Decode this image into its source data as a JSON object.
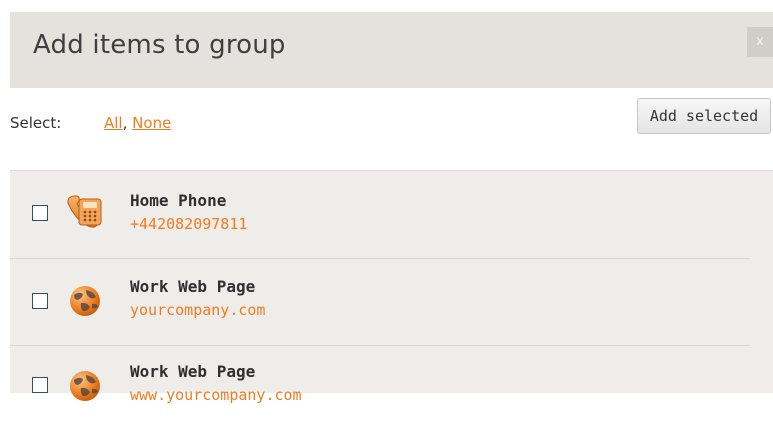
{
  "dialog": {
    "title": "Add items to group",
    "close_label": "x"
  },
  "toolbar": {
    "select_label": "Select:",
    "all_label": "All",
    "separator": ",",
    "none_label": "None",
    "add_selected_label": "Add selected"
  },
  "items": [
    {
      "name": "Home Phone",
      "value": "+442082097811",
      "icon": "phone-icon",
      "checked": false
    },
    {
      "name": "Work Web Page",
      "value": "yourcompany.com",
      "icon": "globe-icon",
      "checked": false
    },
    {
      "name": "Work Web Page",
      "value": "www.yourcompany.com",
      "icon": "globe-icon",
      "checked": false
    }
  ],
  "colors": {
    "accent": "#ee7d20",
    "titlebar": "#e3e2dd",
    "list_bg": "#eeedea"
  }
}
